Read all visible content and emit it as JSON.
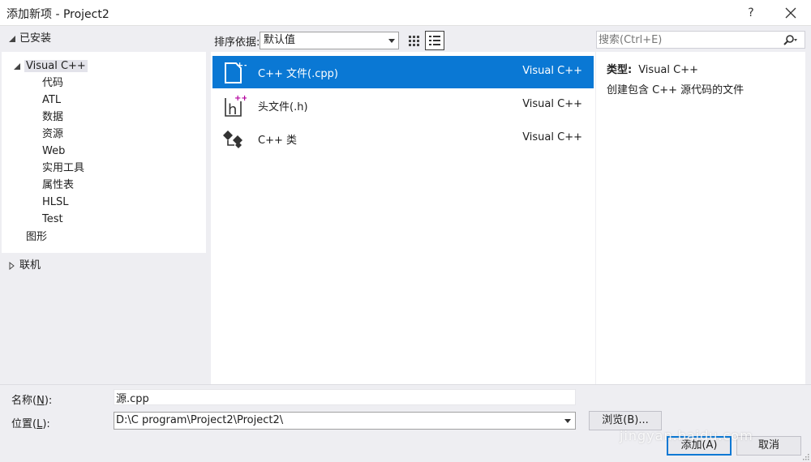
{
  "window": {
    "title": "添加新项 - Project2",
    "help_label": "?",
    "close_icon": "close-icon"
  },
  "sidebar": {
    "installed_label": "已安装",
    "root_label": "Visual C++",
    "children": [
      "代码",
      "ATL",
      "数据",
      "资源",
      "Web",
      "实用工具",
      "属性表",
      "HLSL",
      "Test"
    ],
    "graphics_label": "图形",
    "online_label": "联机"
  },
  "toolbar": {
    "sort_label": "排序依据:",
    "sort_value": "默认值",
    "view_icons": [
      "grid-view-icon",
      "list-view-icon"
    ],
    "search_placeholder": "搜索(Ctrl+E)"
  },
  "templates": [
    {
      "name": "C++ 文件(.cpp)",
      "language": "Visual C++",
      "icon": "cpp-file-icon",
      "selected": true
    },
    {
      "name": "头文件(.h)",
      "language": "Visual C++",
      "icon": "header-file-icon",
      "selected": false
    },
    {
      "name": "C++ 类",
      "language": "Visual C++",
      "icon": "cpp-class-icon",
      "selected": false
    }
  ],
  "detail": {
    "type_label": "类型:",
    "type_value": "Visual C++",
    "description": "创建包含 C++ 源代码的文件"
  },
  "form": {
    "name_label_pre": "名称(",
    "name_label_key": "N",
    "name_label_post": "):",
    "name_value": "源.cpp",
    "location_label_pre": "位置(",
    "location_label_key": "L",
    "location_label_post": "):",
    "location_value": "D:\\C program\\Project2\\Project2\\",
    "browse_label": "浏览(B)...",
    "add_label": "添加(A)",
    "cancel_label": "取消"
  },
  "watermark": "jingyan.baidu.com",
  "colors": {
    "accent": "#0a78d4",
    "panel": "#ffffff",
    "background": "#eeeef2",
    "icon_magenta": "#b4009e"
  }
}
